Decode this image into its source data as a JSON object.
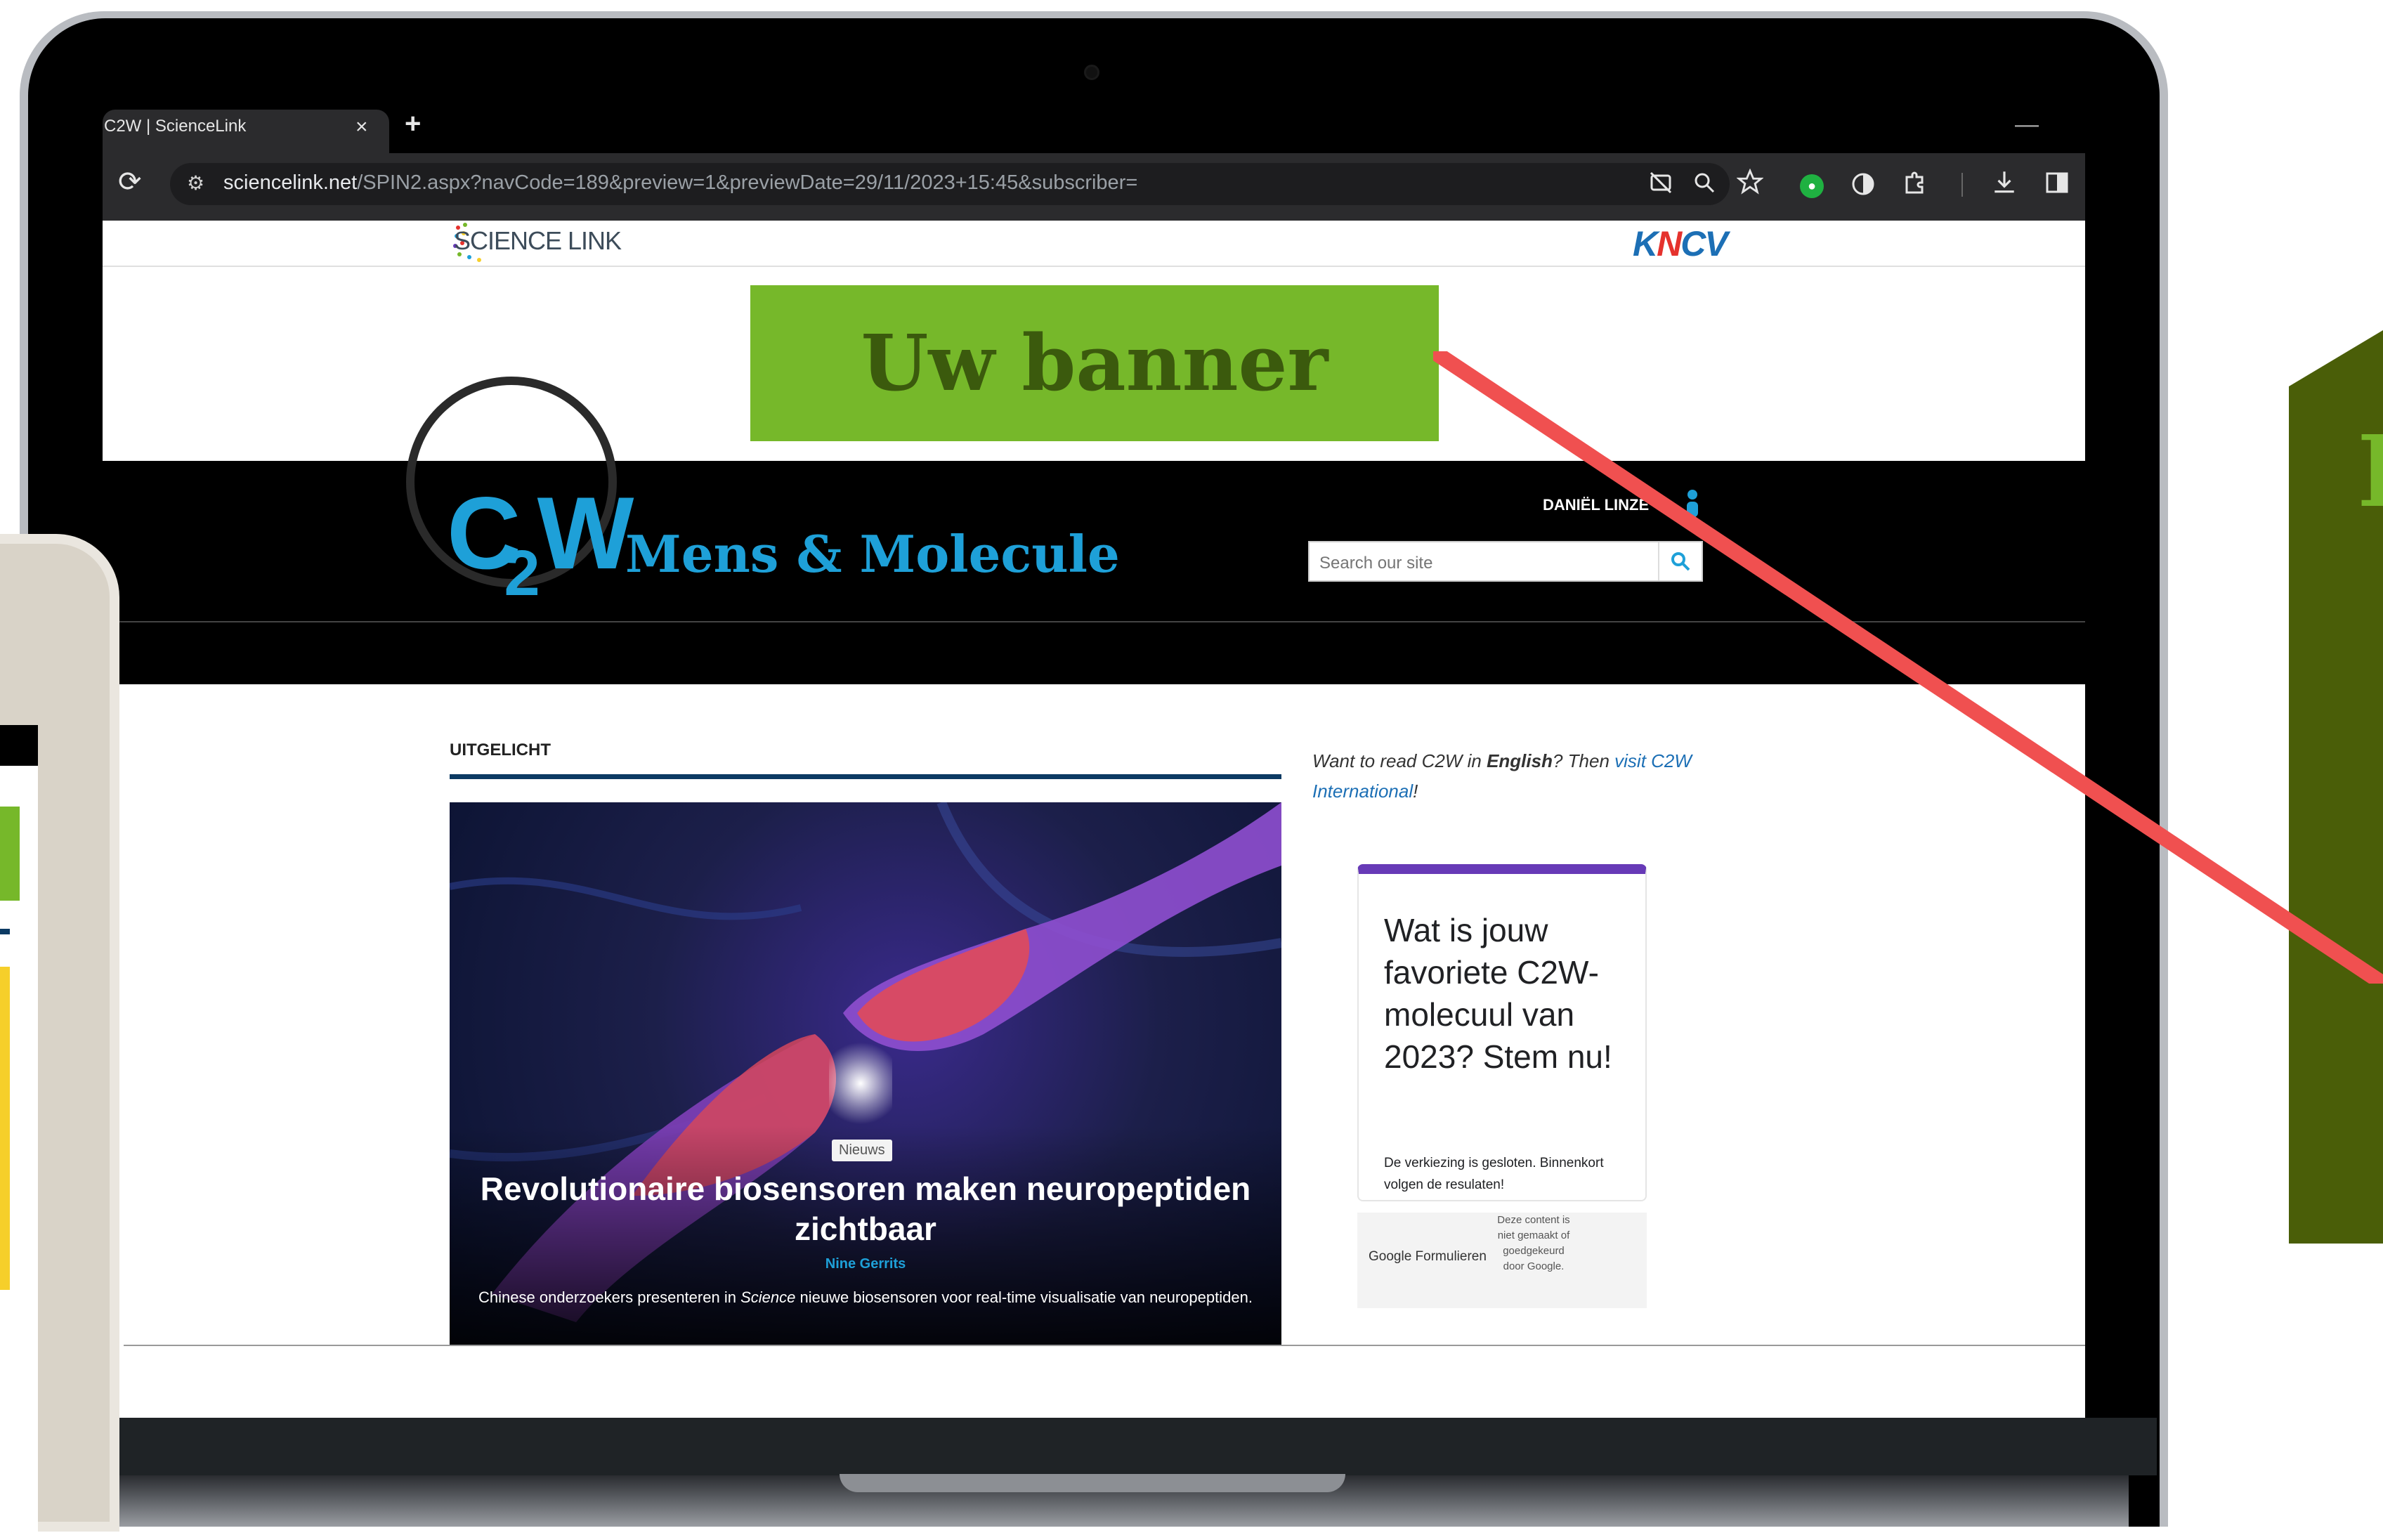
{
  "browser": {
    "tab_title": "C2W | ScienceLink",
    "tab_close": "×",
    "new_tab": "+",
    "minimize": "—",
    "reload": "⟳",
    "site_info_icon": "⚙",
    "url_host": "sciencelink.net",
    "url_path": "/SPIN2.aspx?navCode=189&preview=1&previewDate=29/11/2023+15:45&subscriber=",
    "toolbar_icons": [
      "eye-off-icon",
      "zoom-icon",
      "star-icon",
      "extension-green-icon",
      "circle-half-icon",
      "puzzle-icon",
      "download-icon",
      "sidebar-icon"
    ]
  },
  "top_strip": {
    "sciencelink_logo": "SCIENCE LINK",
    "kncv_logo_prefix": "K",
    "kncv_logo_n": "N",
    "kncv_logo_suffix": "CV"
  },
  "banner": {
    "text": "Uw banner hier!",
    "color": "#76b82a"
  },
  "header": {
    "logo_c": "C",
    "logo_2": "2",
    "logo_w": "W",
    "subtitle": "Mens & Molecule",
    "username": "DANIËL LINZE",
    "search_placeholder": "Search our site"
  },
  "content": {
    "section_label": "UITGELICHT",
    "featured": {
      "badge": "Nieuws",
      "title": "Revolutionaire biosensoren maken neuropeptiden zichtbaar",
      "author": "Nine Gerrits",
      "desc_prefix": "Chinese onderzoekers presenteren in ",
      "desc_em": "Science",
      "desc_suffix": " nieuwe biosensoren voor real-time visualisatie van neuropeptiden."
    },
    "intl": {
      "prefix": "Want to read C2W in ",
      "bold": "English",
      "middle": "? Then ",
      "link": "visit C2W International",
      "suffix": "!"
    },
    "poll": {
      "title": "Wat is jouw favoriete C2W-molecuul van 2023? Stem nu!",
      "note": "De verkiezing is gesloten. Binnenkort volgen de resulaten!",
      "accent": "#673ab7"
    },
    "google_forms": {
      "logo": "Google Formulieren",
      "note": "Deze content is niet gemaakt of goedgekeurd door Google."
    }
  },
  "phone": {
    "menu_icon": "☰",
    "banner_fragment": "!"
  },
  "colors": {
    "brand_blue": "#1ea0d8",
    "dark_navy": "#0c3a63",
    "arrow_red": "#f05050",
    "panel_green": "#4a5e08"
  }
}
